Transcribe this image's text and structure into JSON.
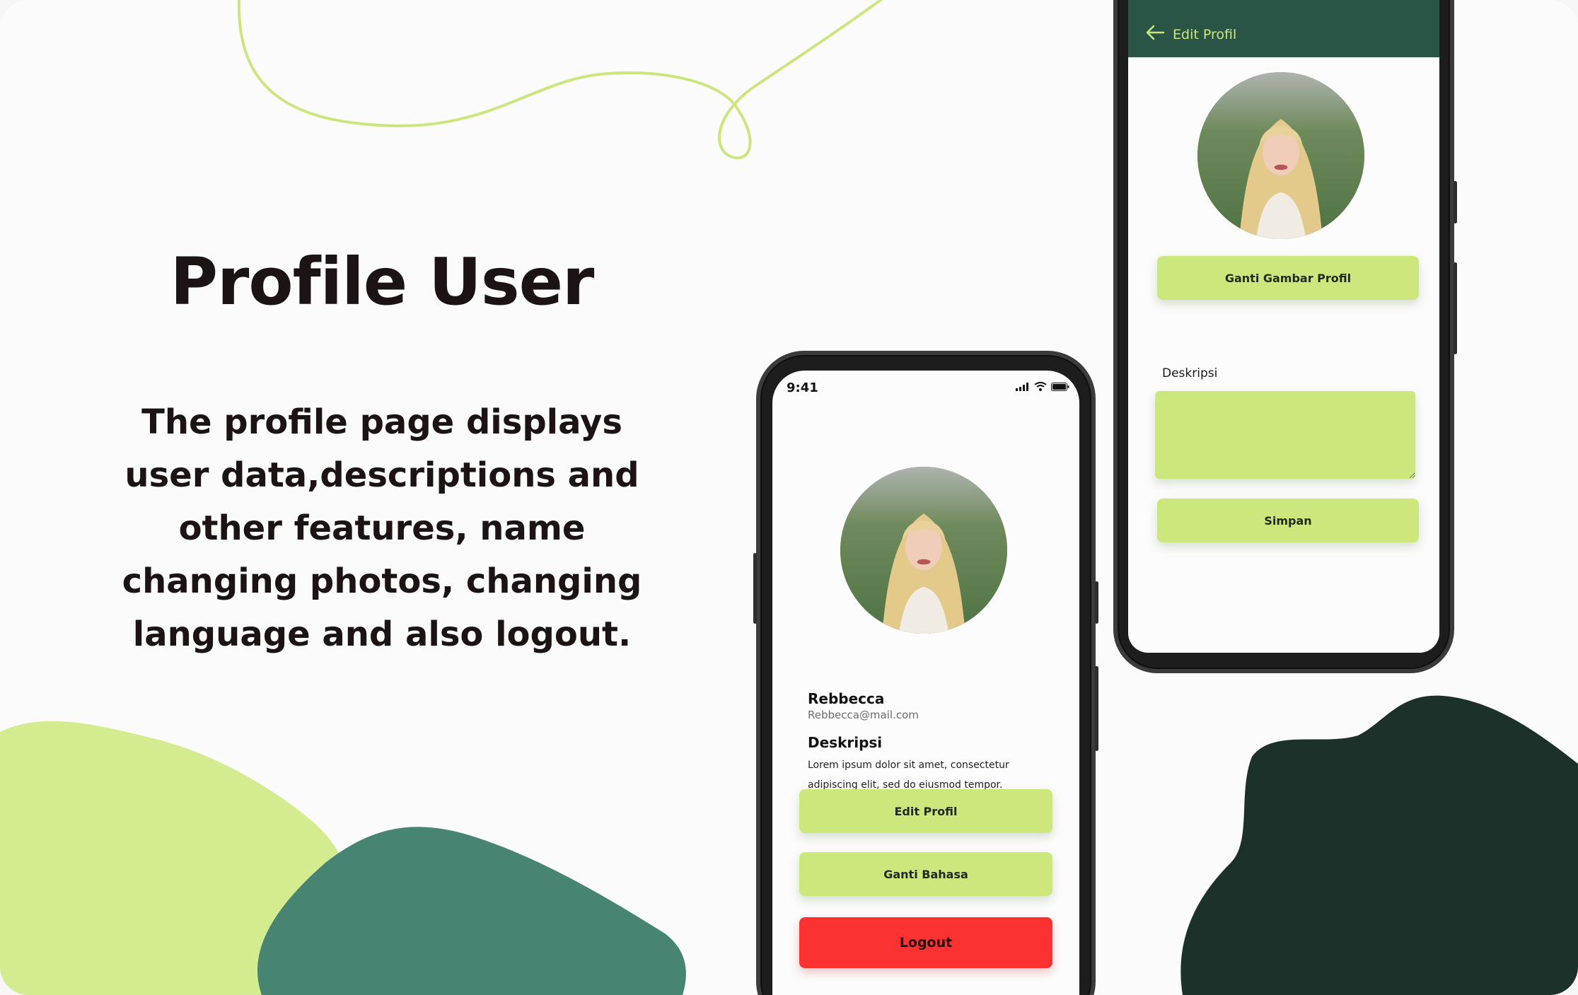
{
  "hero": {
    "title": "Profile User",
    "description": "The profile page displays user data,descriptions and other features, name changing photos, changing language and also logout."
  },
  "colors": {
    "accent_green": "#cce87c",
    "dark_green": "#2a5445",
    "logout_red": "#fc3131",
    "blob_light": "#d2ec8f",
    "blob_mid": "#478472",
    "blob_dark": "#1b3129"
  },
  "phone_profile": {
    "status_time": "9:41",
    "status_icons": [
      "signal-icon",
      "wifi-icon",
      "battery-icon"
    ],
    "user": {
      "name": "Rebbecca",
      "email": "Rebbecca@mail.com"
    },
    "description_label": "Deskripsi",
    "description_text": "Lorem ipsum dolor sit amet, consectetur adipiscing elit, sed do eiusmod tempor.",
    "buttons": {
      "edit": "Edit Profil",
      "language": "Ganti Bahasa",
      "logout": "Logout"
    }
  },
  "phone_edit": {
    "back_icon": "arrow-left-icon",
    "title": "Edit Profil",
    "change_photo_button": "Ganti Gambar Profil",
    "description_label": "Deskripsi",
    "description_value": "",
    "save_button": "Simpan"
  }
}
